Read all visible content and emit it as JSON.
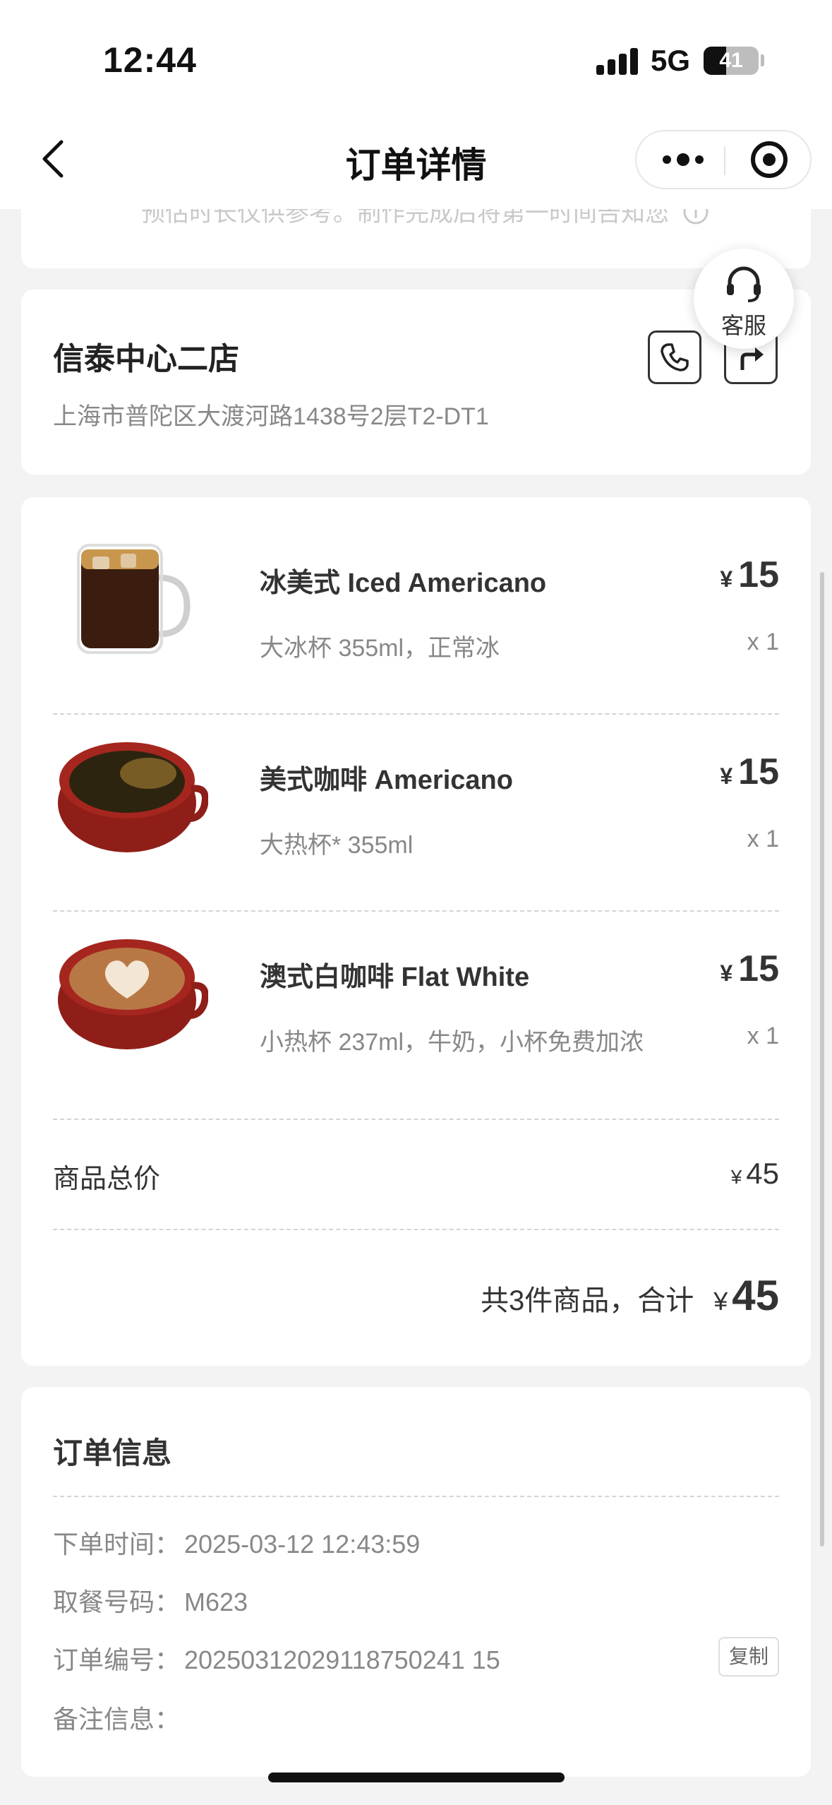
{
  "status_bar": {
    "time": "12:44",
    "network": "5G",
    "battery": "41",
    "battery_level": 0.41
  },
  "nav": {
    "title": "订单详情"
  },
  "top_hint": "预估时长仅供参考。制作完成后将第一时间告知您",
  "store": {
    "name": "信泰中心二店",
    "address": "上海市普陀区大渡河路1438号2层T2-DT1"
  },
  "customer_service": {
    "label": "客服"
  },
  "items": [
    {
      "name": "冰美式 Iced Americano",
      "spec": "大冰杯 355ml，正常冰",
      "currency": "¥",
      "price": "15",
      "qty": "x 1"
    },
    {
      "name": "美式咖啡 Americano",
      "spec": "大热杯* 355ml",
      "currency": "¥",
      "price": "15",
      "qty": "x 1"
    },
    {
      "name": "澳式白咖啡 Flat White",
      "spec": "小热杯 237ml，牛奶，小杯免费加浓",
      "currency": "¥",
      "price": "15",
      "qty": "x 1"
    }
  ],
  "summary": {
    "subtotal_label": "商品总价",
    "currency": "¥",
    "subtotal": "45",
    "total_label": "共3件商品，合计",
    "total": "45"
  },
  "order_info": {
    "title": "订单信息",
    "rows": [
      {
        "key": "下单时间：",
        "value": "2025-03-12 12:43:59"
      },
      {
        "key": "取餐号码：",
        "value": "M623"
      },
      {
        "key": "订单编号：",
        "value": "20250312029118750241 15"
      },
      {
        "key": "备注信息：",
        "value": ""
      }
    ],
    "copy_label": "复制"
  }
}
